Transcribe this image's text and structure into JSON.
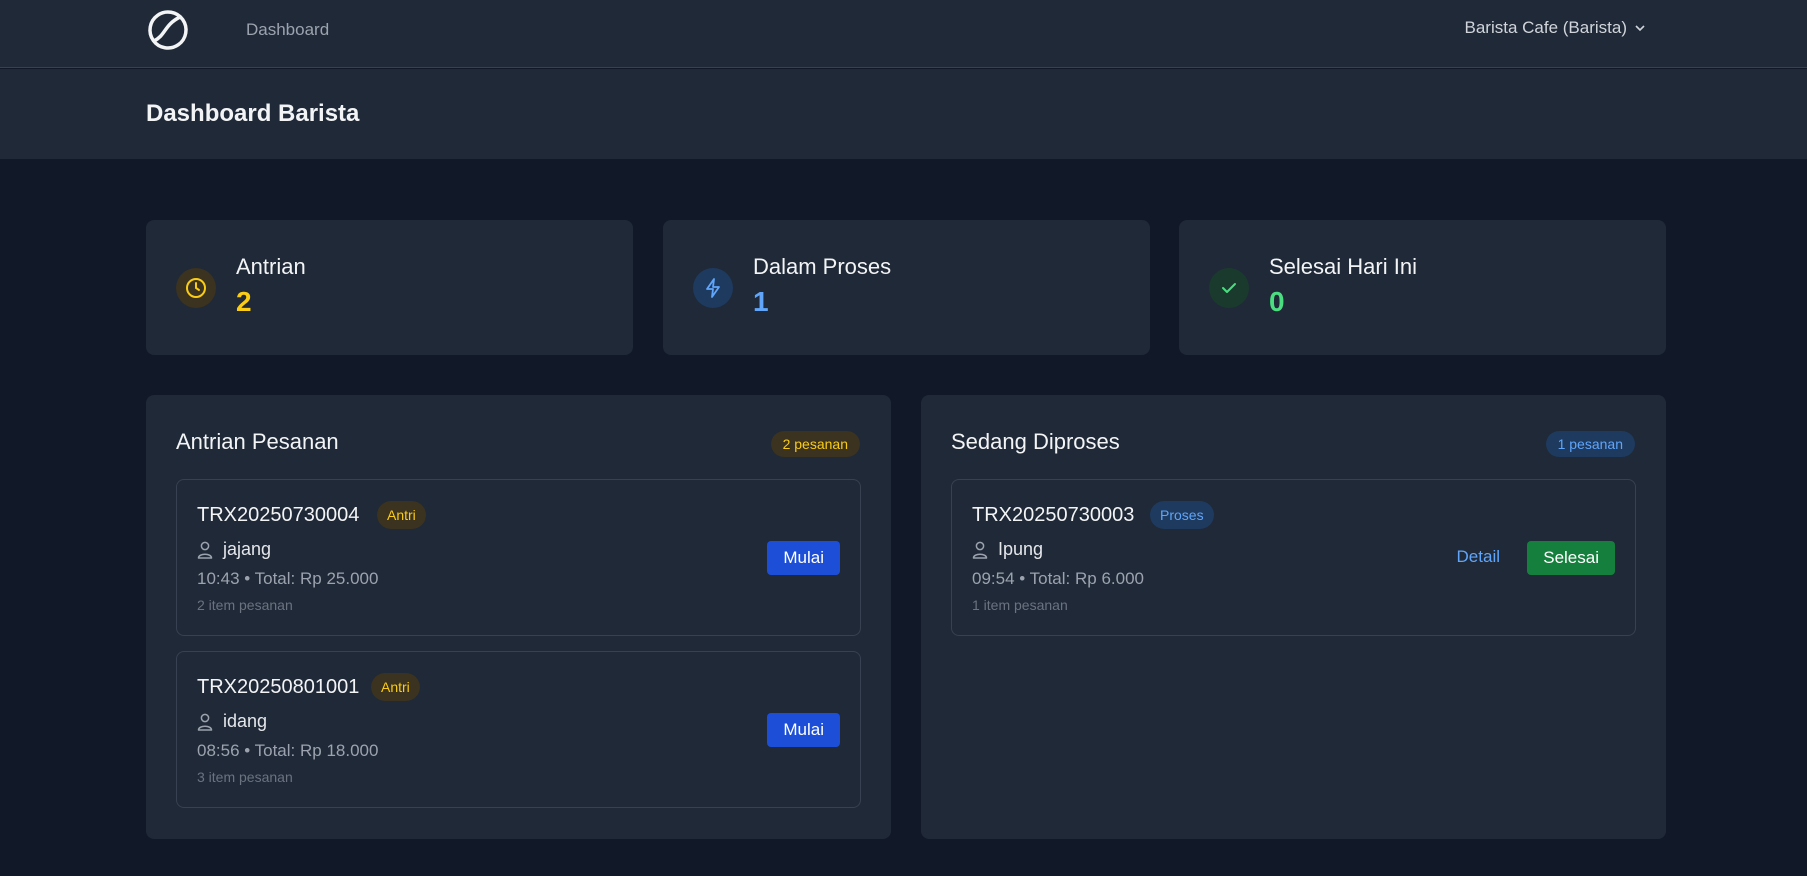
{
  "nav": {
    "link": "Dashboard",
    "user_menu": "Barista Cafe (Barista)"
  },
  "header": {
    "title": "Dashboard Barista"
  },
  "stats": [
    {
      "label": "Antrian",
      "value": "2",
      "color": "#facc15",
      "icon": "clock-icon"
    },
    {
      "label": "Dalam Proses",
      "value": "1",
      "color": "#60a5fa",
      "icon": "lightning-icon"
    },
    {
      "label": "Selesai Hari Ini",
      "value": "0",
      "color": "#4ade80",
      "icon": "check-icon"
    }
  ],
  "queue": {
    "title": "Antrian Pesanan",
    "count": "2 pesanan",
    "orders": [
      {
        "id": "TRX20250730004",
        "status": "Antri",
        "customer": "jajang",
        "meta": "10:43 • Total: Rp 25.000",
        "items": "2 item pesanan",
        "action": "Mulai"
      },
      {
        "id": "TRX20250801001",
        "status": "Antri",
        "customer": "idang",
        "meta": "08:56 • Total: Rp 18.000",
        "items": "3 item pesanan",
        "action": "Mulai"
      }
    ]
  },
  "processing": {
    "title": "Sedang Diproses",
    "count": "1 pesanan",
    "orders": [
      {
        "id": "TRX20250730003",
        "status": "Proses",
        "customer": "Ipung",
        "meta": "09:54 • Total: Rp 6.000",
        "items": "1 item pesanan",
        "detail": "Detail",
        "action": "Selesai"
      }
    ]
  }
}
